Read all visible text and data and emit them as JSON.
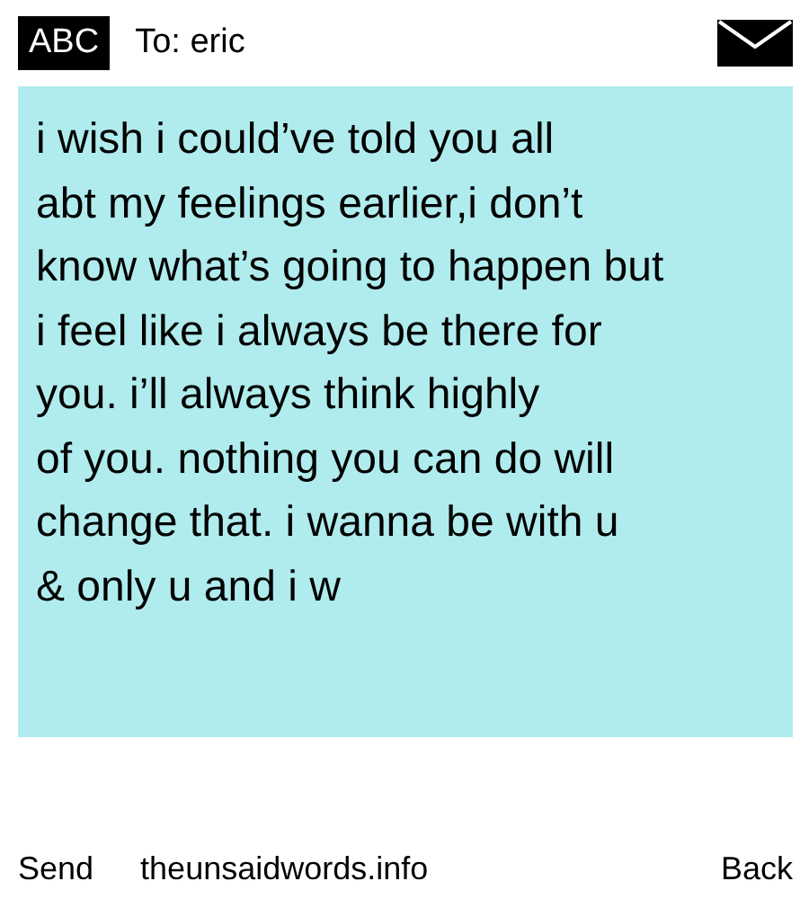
{
  "header": {
    "keyboard_mode": "ABC",
    "recipient": "To: eric"
  },
  "message": {
    "text": "i wish i could’ve told you all\nabt my feelings earlier,i don’t\nknow what’s going to happen but\ni feel like i always be there for\nyou. i’ll always think highly\nof you. nothing you can do will\nchange that. i wanna be with u\n& only u and i w"
  },
  "footer": {
    "left_button": "Send",
    "site": "theunsaidwords.info",
    "right_button": "Back"
  }
}
